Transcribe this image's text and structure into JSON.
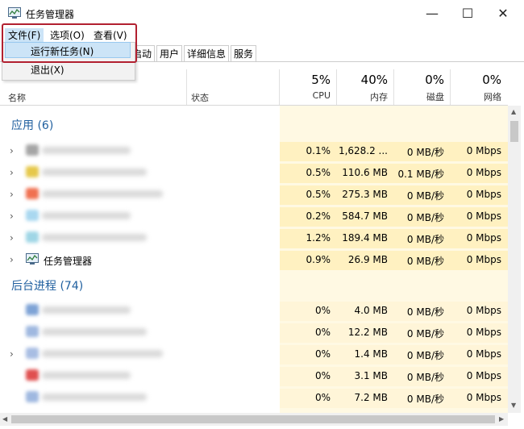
{
  "window": {
    "title": "任务管理器",
    "minimize": "—",
    "maximize": "☐",
    "close": "✕"
  },
  "menubar": {
    "file": "文件(F)",
    "options": "选项(O)",
    "view": "查看(V)"
  },
  "file_menu": {
    "run_new_task": "运行新任务(N)",
    "exit": "退出(X)"
  },
  "tabs": [
    "启动",
    "用户",
    "详细信息",
    "服务"
  ],
  "tabs_partial_first": "启动",
  "columns": {
    "name": "名称",
    "status": "状态",
    "cpu": {
      "pct": "5%",
      "label": "CPU"
    },
    "memory": {
      "pct": "40%",
      "label": "内存"
    },
    "disk": {
      "pct": "0%",
      "label": "磁盘"
    },
    "network": {
      "pct": "0%",
      "label": "网络"
    }
  },
  "groups": {
    "apps": "应用 (6)",
    "background": "后台进程 (74)"
  },
  "apps": [
    {
      "cpu": "0.1%",
      "mem": "1,628.2 ...",
      "disk": "0 MB/秒",
      "net": "0 Mbps",
      "color": "#a5a5a5"
    },
    {
      "cpu": "0.5%",
      "mem": "110.6 MB",
      "disk": "0.1 MB/秒",
      "net": "0 Mbps",
      "color": "#e6c84a"
    },
    {
      "cpu": "0.5%",
      "mem": "275.3 MB",
      "disk": "0 MB/秒",
      "net": "0 Mbps",
      "color": "#f07050"
    },
    {
      "cpu": "0.2%",
      "mem": "584.7 MB",
      "disk": "0 MB/秒",
      "net": "0 Mbps",
      "color": "#a9d8f0"
    },
    {
      "cpu": "1.2%",
      "mem": "189.4 MB",
      "disk": "0 MB/秒",
      "net": "0 Mbps",
      "color": "#9fd6e6"
    },
    {
      "name": "任务管理器",
      "cpu": "0.9%",
      "mem": "26.9 MB",
      "disk": "0 MB/秒",
      "net": "0 Mbps"
    }
  ],
  "background": [
    {
      "cpu": "0%",
      "mem": "4.0 MB",
      "disk": "0 MB/秒",
      "net": "0 Mbps",
      "color": "#7ea3d6"
    },
    {
      "cpu": "0%",
      "mem": "12.2 MB",
      "disk": "0 MB/秒",
      "net": "0 Mbps",
      "color": "#9fb8e0"
    },
    {
      "cpu": "0%",
      "mem": "1.4 MB",
      "disk": "0 MB/秒",
      "net": "0 Mbps",
      "color": "#a8bde3"
    },
    {
      "cpu": "0%",
      "mem": "3.1 MB",
      "disk": "0 MB/秒",
      "net": "0 Mbps",
      "color": "#e05050"
    },
    {
      "cpu": "0%",
      "mem": "7.2 MB",
      "disk": "0 MB/秒",
      "net": "0 Mbps",
      "color": "#9fb8e0"
    }
  ]
}
